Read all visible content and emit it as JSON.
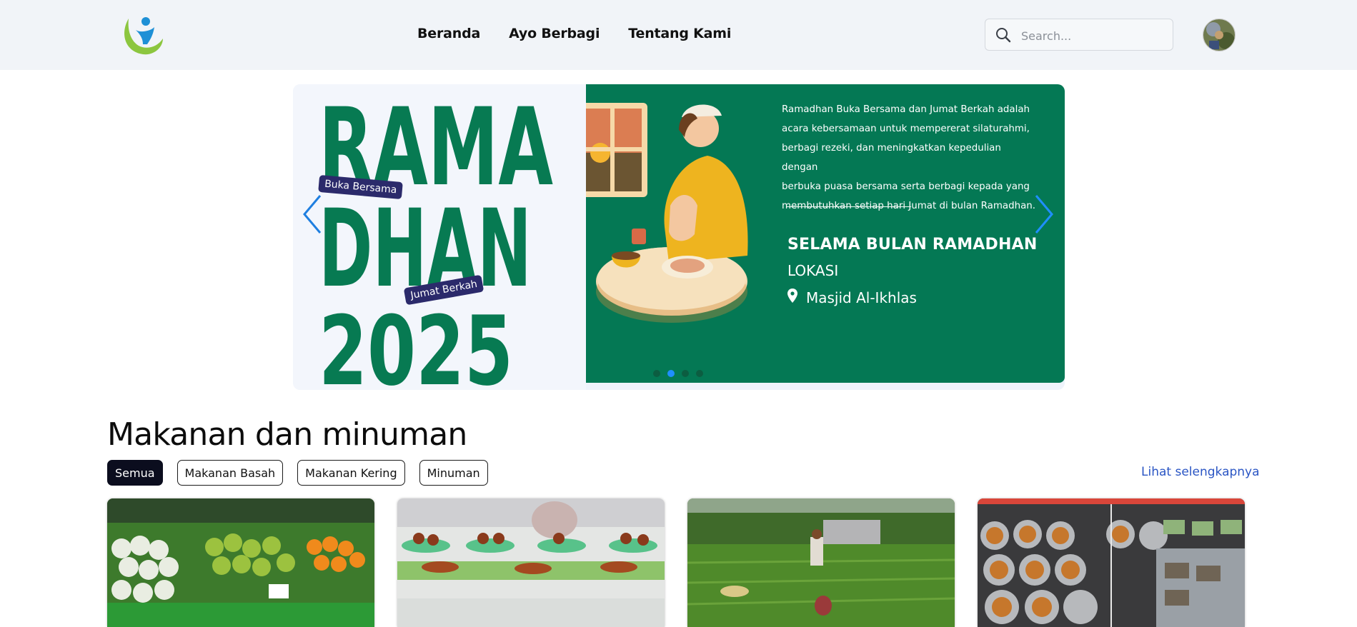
{
  "header": {
    "nav": [
      "Beranda",
      "Ayo Berbagi",
      "Tentang Kami"
    ],
    "search_placeholder": "Search..."
  },
  "hero": {
    "big_text": [
      "RAMA",
      "DHAN",
      "2025"
    ],
    "badges": [
      "Buka Bersama",
      "Jumat Berkah"
    ],
    "description_lines": [
      "Ramadhan Buka Bersama dan Jumat Berkah adalah",
      "acara kebersamaan untuk mempererat silaturahmi,",
      "berbagi rezeki, dan meningkatkan kepedulian dengan",
      "berbuka puasa bersama serta berbagi kepada yang",
      "membutuhkan setiap hari Jumat di bulan Ramadhan."
    ],
    "title": "SELAMA BULAN RAMADHAN",
    "location_label": "LOKASI",
    "location": "Masjid Al-Ikhlas",
    "slide_count": 4,
    "active_slide": 1,
    "colors": {
      "green": "#047854",
      "navy": "#2b2a6b",
      "accent": "#1f8fff"
    }
  },
  "section": {
    "title": "Makanan dan minuman",
    "filters": [
      "Semua",
      "Makanan Basah",
      "Makanan Kering",
      "Minuman"
    ],
    "active_filter": 0,
    "see_more": "Lihat selengkapnya"
  },
  "icons": {
    "search": "search-icon",
    "prev": "chevron-left-icon",
    "next": "chevron-right-icon",
    "location": "map-pin-icon"
  }
}
